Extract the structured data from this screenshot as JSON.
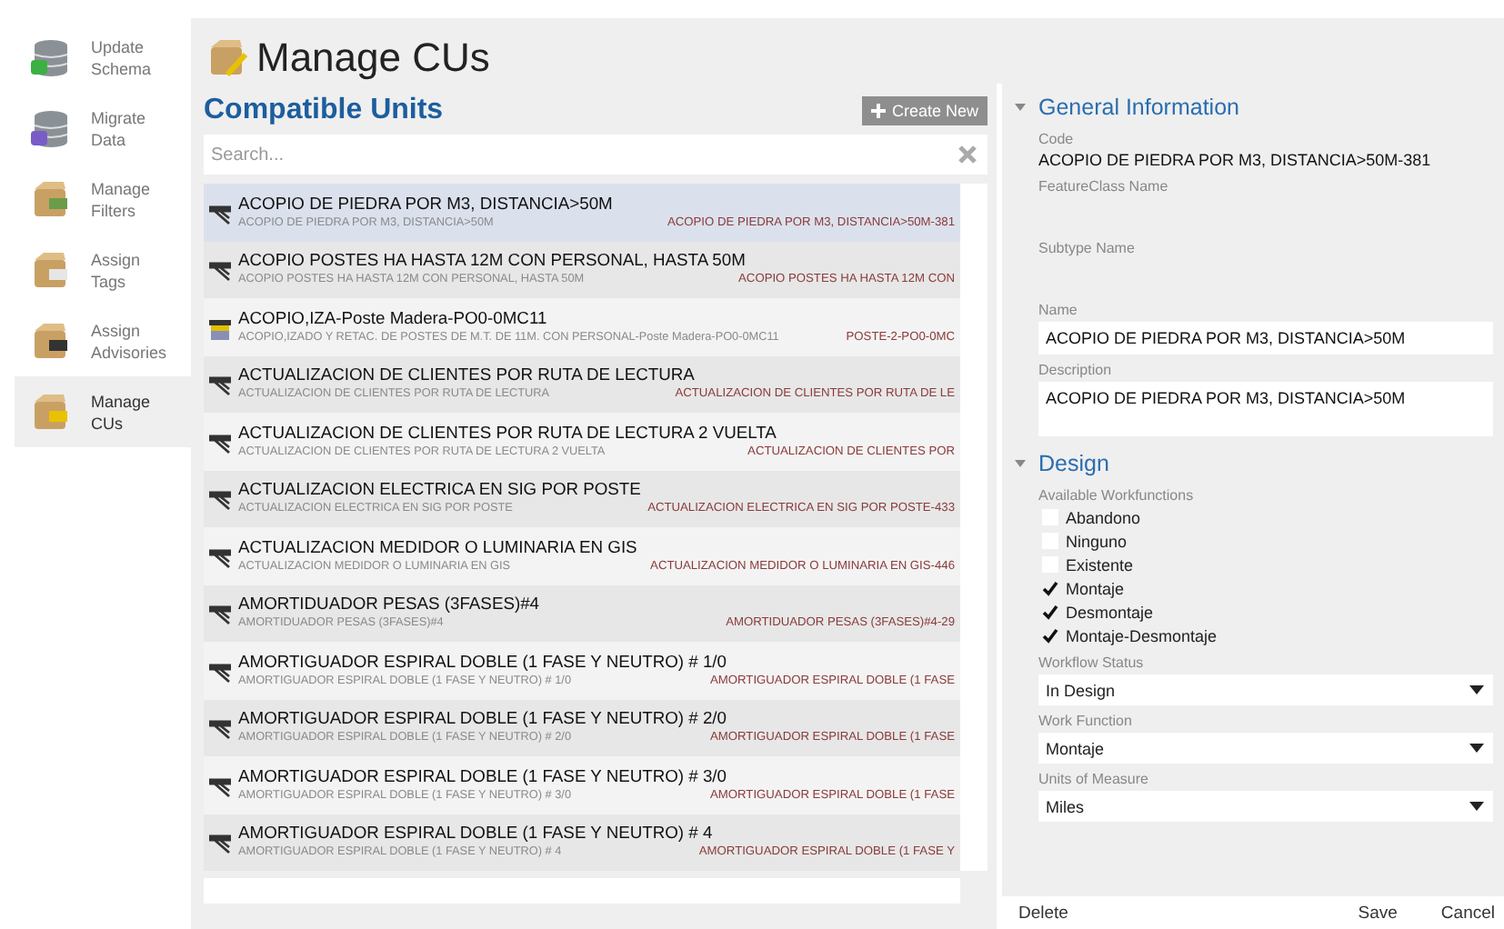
{
  "sidebar": {
    "items": [
      {
        "label": "Update Schema",
        "selected": false
      },
      {
        "label": "Migrate Data",
        "selected": false
      },
      {
        "label": "Manage Filters",
        "selected": false
      },
      {
        "label": "Assign Tags",
        "selected": false
      },
      {
        "label": "Assign Advisories",
        "selected": false
      },
      {
        "label": "Manage CUs",
        "selected": true
      }
    ]
  },
  "page_title": "Manage CUs",
  "list_panel": {
    "title": "Compatible Units",
    "create_button": "Create New",
    "search": {
      "placeholder": "Search..."
    },
    "rows": [
      {
        "title": "ACOPIO DE PIEDRA POR M3, DISTANCIA>50M",
        "subtitle": "ACOPIO DE PIEDRA POR M3, DISTANCIA>50M",
        "code": "ACOPIO DE PIEDRA POR M3, DISTANCIA>50M-381",
        "kind": "line",
        "selected": true
      },
      {
        "title": "ACOPIO POSTES HA HASTA 12M CON PERSONAL, HASTA 50M",
        "subtitle": "ACOPIO POSTES HA HASTA 12M CON PERSONAL, HASTA 50M",
        "code": "ACOPIO POSTES HA HASTA 12M CON",
        "kind": "line",
        "selected": false
      },
      {
        "title": "ACOPIO,IZA-Poste Madera-PO0-0MC11",
        "subtitle": "ACOPIO,IZADO Y RETAC. DE POSTES DE M.T. DE 11M. CON PERSONAL-Poste Madera-PO0-0MC11",
        "code": "POSTE-2-PO0-0MC",
        "kind": "pole",
        "selected": false
      },
      {
        "title": "ACTUALIZACION DE CLIENTES POR RUTA DE LECTURA",
        "subtitle": "ACTUALIZACION DE CLIENTES POR RUTA DE LECTURA",
        "code": "ACTUALIZACION DE CLIENTES POR RUTA DE LE",
        "kind": "line",
        "selected": false
      },
      {
        "title": "ACTUALIZACION DE CLIENTES POR RUTA DE LECTURA 2 VUELTA",
        "subtitle": "ACTUALIZACION DE CLIENTES POR RUTA DE LECTURA 2 VUELTA",
        "code": "ACTUALIZACION DE CLIENTES POR",
        "kind": "line",
        "selected": false
      },
      {
        "title": "ACTUALIZACION ELECTRICA EN SIG POR POSTE",
        "subtitle": "ACTUALIZACION ELECTRICA EN SIG POR POSTE",
        "code": "ACTUALIZACION ELECTRICA EN SIG POR POSTE-433",
        "kind": "line",
        "selected": false
      },
      {
        "title": "ACTUALIZACION MEDIDOR O LUMINARIA EN GIS",
        "subtitle": "ACTUALIZACION MEDIDOR O LUMINARIA EN GIS",
        "code": "ACTUALIZACION MEDIDOR O LUMINARIA EN GIS-446",
        "kind": "line",
        "selected": false
      },
      {
        "title": "AMORTIDUADOR PESAS (3FASES)#4",
        "subtitle": "AMORTIDUADOR PESAS (3FASES)#4",
        "code": "AMORTIDUADOR PESAS (3FASES)#4-29",
        "kind": "line",
        "selected": false
      },
      {
        "title": "AMORTIGUADOR ESPIRAL DOBLE (1 FASE Y NEUTRO) # 1/0",
        "subtitle": "AMORTIGUADOR ESPIRAL DOBLE (1 FASE Y NEUTRO) # 1/0",
        "code": "AMORTIGUADOR ESPIRAL DOBLE (1 FASE",
        "kind": "line",
        "selected": false
      },
      {
        "title": "AMORTIGUADOR ESPIRAL DOBLE (1 FASE Y NEUTRO) # 2/0",
        "subtitle": "AMORTIGUADOR ESPIRAL DOBLE (1 FASE Y NEUTRO) # 2/0",
        "code": "AMORTIGUADOR ESPIRAL DOBLE (1 FASE",
        "kind": "line",
        "selected": false
      },
      {
        "title": "AMORTIGUADOR ESPIRAL DOBLE (1 FASE Y NEUTRO) # 3/0",
        "subtitle": "AMORTIGUADOR ESPIRAL DOBLE (1 FASE Y NEUTRO) # 3/0",
        "code": "AMORTIGUADOR ESPIRAL DOBLE (1 FASE",
        "kind": "line",
        "selected": false
      },
      {
        "title": "AMORTIGUADOR ESPIRAL DOBLE (1 FASE Y NEUTRO) # 4",
        "subtitle": "AMORTIGUADOR ESPIRAL DOBLE (1 FASE Y NEUTRO) # 4",
        "code": "AMORTIGUADOR ESPIRAL DOBLE (1 FASE Y",
        "kind": "line",
        "selected": false
      }
    ]
  },
  "details": {
    "general": {
      "title": "General Information",
      "expanded": true,
      "fields": [
        {
          "label": "Code",
          "value": "ACOPIO DE PIEDRA POR M3, DISTANCIA>50M-381",
          "kind": "text"
        },
        {
          "label": "FeatureClass Name",
          "kind": "text"
        },
        {
          "label": "Subtype Name",
          "kind": "text"
        },
        {
          "label": "Name",
          "value": "ACOPIO DE PIEDRA POR M3, DISTANCIA>50M",
          "kind": "input"
        },
        {
          "label": "Description",
          "value": "ACOPIO DE PIEDRA POR M3, DISTANCIA>50M",
          "kind": "textarea"
        }
      ]
    },
    "design": {
      "title": "Design",
      "expanded": true,
      "workfunctions_label": "Available Workfunctions",
      "workfunctions": [
        {
          "label": "Abandono",
          "checked": false
        },
        {
          "label": "Ninguno",
          "checked": false
        },
        {
          "label": "Existente",
          "checked": false
        },
        {
          "label": "Montaje",
          "checked": true
        },
        {
          "label": "Desmontaje",
          "checked": true
        },
        {
          "label": "Montaje-Desmontaje",
          "checked": true
        }
      ],
      "dropdowns": [
        {
          "label": "Workflow Status",
          "value": "In Design"
        },
        {
          "label": "Work Function",
          "value": "Montaje"
        },
        {
          "label": "Units of Measure",
          "value": "Miles"
        }
      ]
    },
    "buttons": {
      "delete": "Delete",
      "save": "Save",
      "cancel": "Cancel"
    }
  }
}
